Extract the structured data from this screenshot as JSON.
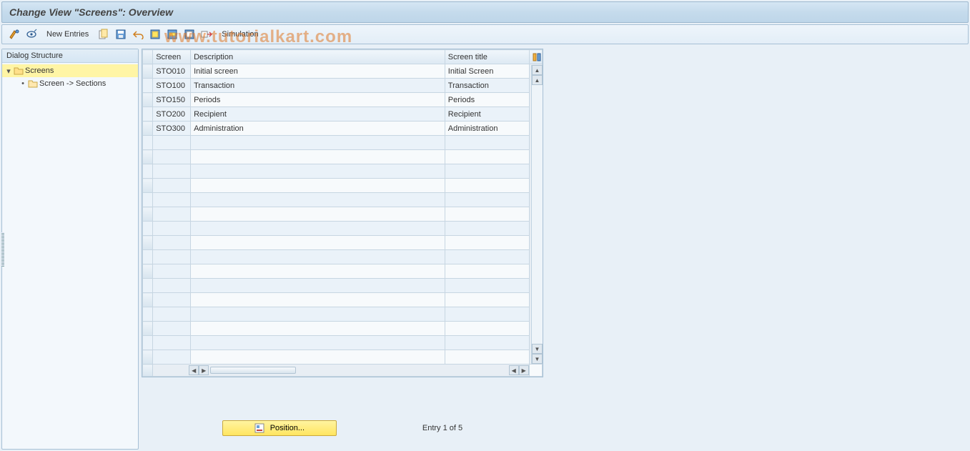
{
  "title": "Change View \"Screens\": Overview",
  "watermark": "www.tutorialkart.com",
  "toolbar": {
    "new_entries": "New Entries",
    "simulation": "Simulation"
  },
  "sidebar": {
    "header": "Dialog Structure",
    "nodes": {
      "screens": "Screens",
      "screen_sections": "Screen -> Sections"
    }
  },
  "table": {
    "columns": {
      "screen": "Screen",
      "description": "Description",
      "screen_title": "Screen title"
    },
    "rows": [
      {
        "screen": "STO010",
        "description": "Initial screen",
        "title": "Initial Screen"
      },
      {
        "screen": "STO100",
        "description": "Transaction",
        "title": "Transaction"
      },
      {
        "screen": "STO150",
        "description": "Periods",
        "title": "Periods"
      },
      {
        "screen": "STO200",
        "description": "Recipient",
        "title": "Recipient"
      },
      {
        "screen": "STO300",
        "description": "Administration",
        "title": "Administration"
      }
    ]
  },
  "footer": {
    "position_label": "Position...",
    "entry_text": "Entry 1 of 5"
  },
  "icons": {
    "toggle": "toggle-icon",
    "glasses": "glasses-icon",
    "copy": "copy-icon",
    "save_variant": "save-variant-icon",
    "undo": "undo-icon",
    "select_all": "select-all-icon",
    "deselect_all": "deselect-all-icon",
    "select_block": "select-block-icon",
    "delimit": "delimit-icon",
    "table_settings": "table-settings-icon",
    "position": "position-icon"
  }
}
